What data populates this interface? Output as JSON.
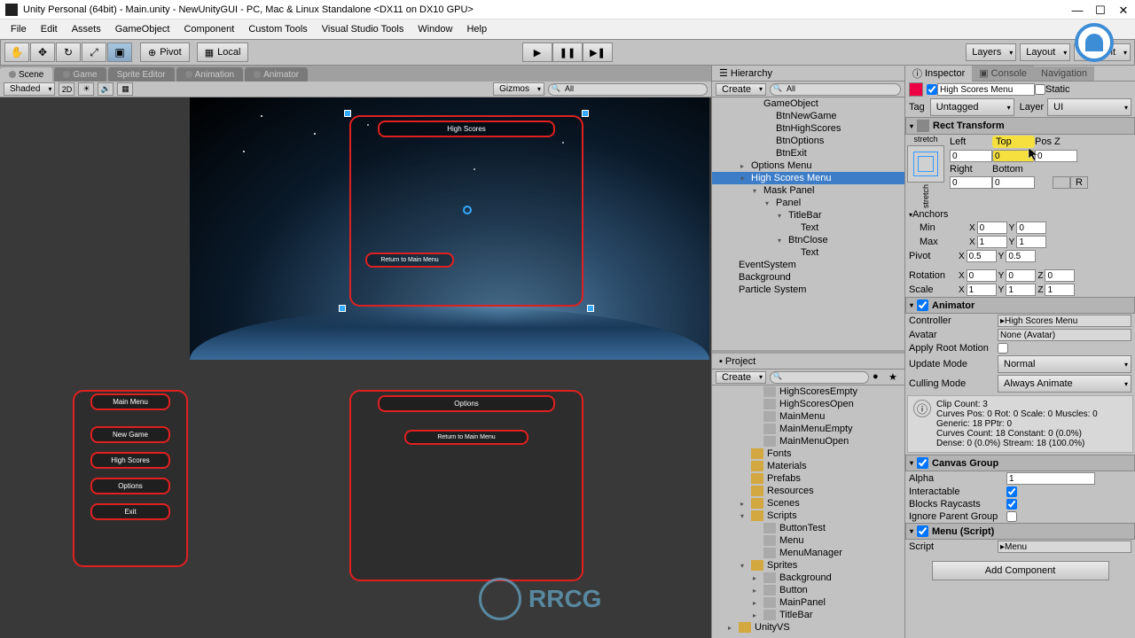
{
  "window": {
    "title": "Unity Personal (64bit) - Main.unity - NewUnityGUI - PC, Mac & Linux Standalone <DX11 on DX10 GPU>"
  },
  "menubar": [
    "File",
    "Edit",
    "Assets",
    "GameObject",
    "Component",
    "Custom Tools",
    "Visual Studio Tools",
    "Window",
    "Help"
  ],
  "toolbar": {
    "pivot": "Pivot",
    "local": "Local",
    "layers": "Layers",
    "layout": "Layout",
    "account": "Account"
  },
  "tabs_left": [
    "Scene",
    "Game",
    "Sprite Editor",
    "Animation",
    "Animator"
  ],
  "scene_toolbar": {
    "shaded": "Shaded",
    "mode2d": "2D",
    "gizmos": "Gizmos",
    "search": "All"
  },
  "scene_content": {
    "title1": "High Scores",
    "return1": "Return to Main Menu",
    "menu_items": [
      "Main Menu",
      "New Game",
      "High Scores",
      "Options",
      "Exit"
    ],
    "title2": "Options",
    "return2": "Return to Main Menu"
  },
  "hierarchy": {
    "tab": "Hierarchy",
    "create": "Create",
    "search": "All",
    "items": [
      {
        "label": "GameObject",
        "indent": 3
      },
      {
        "label": "BtnNewGame",
        "indent": 4
      },
      {
        "label": "BtnHighScores",
        "indent": 4
      },
      {
        "label": "BtnOptions",
        "indent": 4
      },
      {
        "label": "BtnExit",
        "indent": 4
      },
      {
        "label": "Options Menu",
        "indent": 2,
        "arrow": "▸"
      },
      {
        "label": "High Scores Menu",
        "indent": 2,
        "arrow": "▾",
        "selected": true
      },
      {
        "label": "Mask Panel",
        "indent": 3,
        "arrow": "▾"
      },
      {
        "label": "Panel",
        "indent": 4,
        "arrow": "▾"
      },
      {
        "label": "TitleBar",
        "indent": 5,
        "arrow": "▾"
      },
      {
        "label": "Text",
        "indent": 6
      },
      {
        "label": "BtnClose",
        "indent": 5,
        "arrow": "▾"
      },
      {
        "label": "Text",
        "indent": 6
      },
      {
        "label": "EventSystem",
        "indent": 1
      },
      {
        "label": "Background",
        "indent": 1
      },
      {
        "label": "Particle System",
        "indent": 1
      }
    ]
  },
  "project": {
    "tab": "Project",
    "create": "Create",
    "items": [
      {
        "label": "HighScoresEmpty",
        "indent": 3,
        "icon": "file"
      },
      {
        "label": "HighScoresOpen",
        "indent": 3,
        "icon": "file"
      },
      {
        "label": "MainMenu",
        "indent": 3,
        "icon": "file"
      },
      {
        "label": "MainMenuEmpty",
        "indent": 3,
        "icon": "file"
      },
      {
        "label": "MainMenuOpen",
        "indent": 3,
        "icon": "file"
      },
      {
        "label": "Fonts",
        "indent": 2,
        "icon": "folder"
      },
      {
        "label": "Materials",
        "indent": 2,
        "icon": "folder"
      },
      {
        "label": "Prefabs",
        "indent": 2,
        "icon": "folder"
      },
      {
        "label": "Resources",
        "indent": 2,
        "icon": "folder"
      },
      {
        "label": "Scenes",
        "indent": 2,
        "icon": "folder",
        "arrow": "▸"
      },
      {
        "label": "Scripts",
        "indent": 2,
        "icon": "folder",
        "arrow": "▾"
      },
      {
        "label": "ButtonTest",
        "indent": 3,
        "icon": "file"
      },
      {
        "label": "Menu",
        "indent": 3,
        "icon": "file"
      },
      {
        "label": "MenuManager",
        "indent": 3,
        "icon": "file"
      },
      {
        "label": "Sprites",
        "indent": 2,
        "icon": "folder",
        "arrow": "▾"
      },
      {
        "label": "Background",
        "indent": 3,
        "icon": "file",
        "arrow": "▸"
      },
      {
        "label": "Button",
        "indent": 3,
        "icon": "file",
        "arrow": "▸"
      },
      {
        "label": "MainPanel",
        "indent": 3,
        "icon": "file",
        "arrow": "▸"
      },
      {
        "label": "TitleBar",
        "indent": 3,
        "icon": "file",
        "arrow": "▸"
      },
      {
        "label": "UnityVS",
        "indent": 1,
        "icon": "folder",
        "arrow": "▸"
      }
    ]
  },
  "inspector": {
    "tabs": [
      "Inspector",
      "Console",
      "Navigation"
    ],
    "object_name": "High Scores Menu",
    "static": "Static",
    "tag_label": "Tag",
    "tag_value": "Untagged",
    "layer_label": "Layer",
    "layer_value": "UI",
    "rect_transform": {
      "title": "Rect Transform",
      "stretch": "stretch",
      "left_label": "Left",
      "left": "0",
      "top_label": "Top",
      "top": "0",
      "posz_label": "Pos Z",
      "posz": "0",
      "right_label": "Right",
      "right": "0",
      "bottom_label": "Bottom",
      "bottom": "0",
      "r_btn": "R",
      "anchors": "Anchors",
      "min_label": "Min",
      "min_x": "0",
      "min_y": "0",
      "max_label": "Max",
      "max_x": "1",
      "max_y": "1",
      "pivot_label": "Pivot",
      "pivot_x": "0.5",
      "pivot_y": "0.5",
      "rotation_label": "Rotation",
      "rot_x": "0",
      "rot_y": "0",
      "rot_z": "0",
      "scale_label": "Scale",
      "scale_x": "1",
      "scale_y": "1",
      "scale_z": "1"
    },
    "animator": {
      "title": "Animator",
      "controller_label": "Controller",
      "controller": "High Scores Menu",
      "avatar_label": "Avatar",
      "avatar": "None (Avatar)",
      "root_motion_label": "Apply Root Motion",
      "update_mode_label": "Update Mode",
      "update_mode": "Normal",
      "culling_mode_label": "Culling Mode",
      "culling_mode": "Always Animate",
      "info1": "Clip Count: 3",
      "info2": "Curves Pos: 0 Rot: 0 Scale: 0 Muscles: 0",
      "info3": "Generic: 18 PPtr: 0",
      "info4": "Curves Count: 18 Constant: 0 (0.0%)",
      "info5": "Dense: 0 (0.0%) Stream: 18 (100.0%)"
    },
    "canvas_group": {
      "title": "Canvas Group",
      "alpha_label": "Alpha",
      "alpha": "1",
      "interactable_label": "Interactable",
      "blocks_label": "Blocks Raycasts",
      "ignore_label": "Ignore Parent Group"
    },
    "menu_script": {
      "title": "Menu (Script)",
      "script_label": "Script",
      "script": "Menu"
    },
    "add_component": "Add Component"
  },
  "watermark": "RRCG"
}
